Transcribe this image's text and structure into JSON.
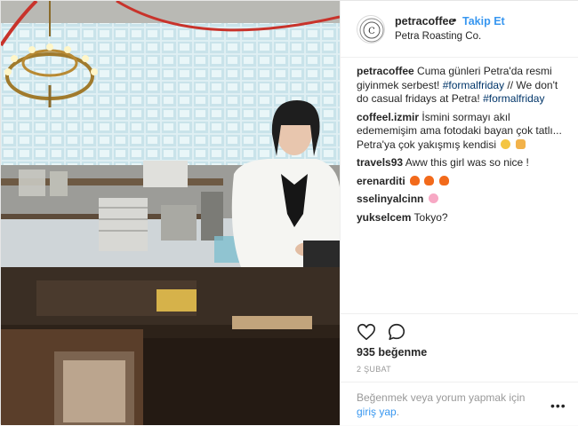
{
  "post": {
    "username": "petracoffee",
    "follow_label": "Takip Et",
    "location": "Petra Roasting Co.",
    "caption": {
      "username": "petracoffee",
      "text_1": "Cuma günleri Petra'da resmi giyinmek serbest!",
      "hashtag_1": "#formalfriday",
      "text_2": "// We don't do casual fridays at Petra!",
      "hashtag_2": "#formalfriday"
    },
    "comments": [
      {
        "username": "coffeel.izmir",
        "text": "İsmini sormayı akıl edememişim ama fotodaki bayan çok tatlı... Petra'ya çok yakışmış kendisi",
        "emoji": [
          "smile-emoji",
          "fingers-crossed-emoji"
        ]
      },
      {
        "username": "travels93",
        "text": "Aww this girl was so nice !"
      },
      {
        "username": "erenarditi",
        "text": "",
        "emoji": [
          "fire-emoji",
          "fire-emoji",
          "fire-emoji"
        ]
      },
      {
        "username": "sselinyalcinn",
        "text": "",
        "emoji": [
          "blossom-emoji"
        ]
      },
      {
        "username": "yukselcem",
        "text": "Tokyo?"
      }
    ],
    "likes": "935 beğenme",
    "date": "2 ŞUBAT",
    "login_prompt": "Beğenmek veya yorum yapmak için",
    "login_link": "giriş yap",
    "login_period": ".",
    "more_icon": "•••"
  },
  "colors": {
    "link": "#3897f0",
    "hashtag": "#003569",
    "muted": "#999999",
    "text": "#262626"
  }
}
